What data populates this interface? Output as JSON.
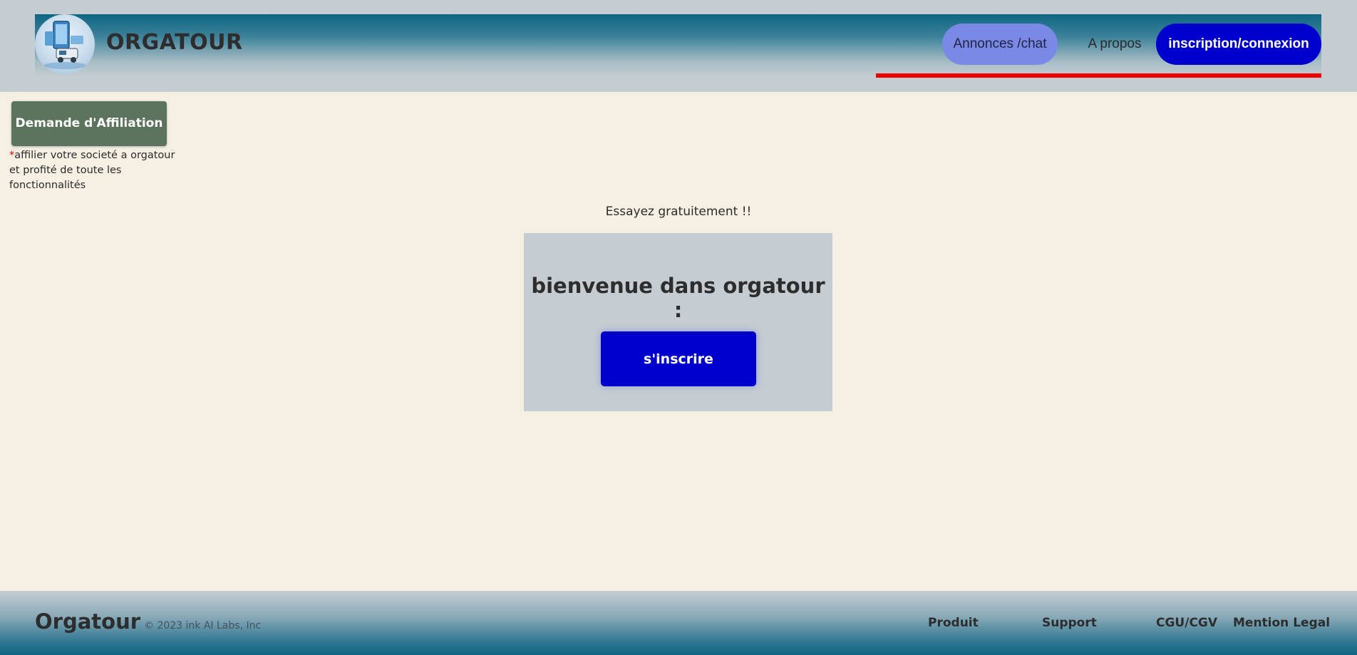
{
  "header": {
    "brand": "ORGATOUR",
    "logo_icon": "orgatour-logo-icon",
    "nav": {
      "annonces": "Annonces /chat",
      "apropos": "A propos",
      "login": "inscription/connexion"
    }
  },
  "sidebar": {
    "affiliation_button": "Demande d'Affiliation",
    "note_star": "*",
    "note_text": "affilier votre societé a orgatour et profité de toute les fonctionnalités"
  },
  "main": {
    "tagline": "Essayez gratuitement !!",
    "welcome_title": "bienvenue dans orgatour :",
    "signup_button": "s'inscrire"
  },
  "footer": {
    "brand": "Orgatour",
    "copyright": "© 2023 ink AI Labs, Inc",
    "links": {
      "produit": "Produit",
      "support": "Support",
      "cgu": "CGU/CGV",
      "mention": "Mention Legal"
    }
  },
  "colors": {
    "accent_blue": "#0000cc",
    "nav_active": "#7a88e6",
    "underline_red": "#ee0000",
    "affiliation_green": "#5c735d",
    "page_bg": "#f5f0e3",
    "header_teal": "#0f6682"
  }
}
